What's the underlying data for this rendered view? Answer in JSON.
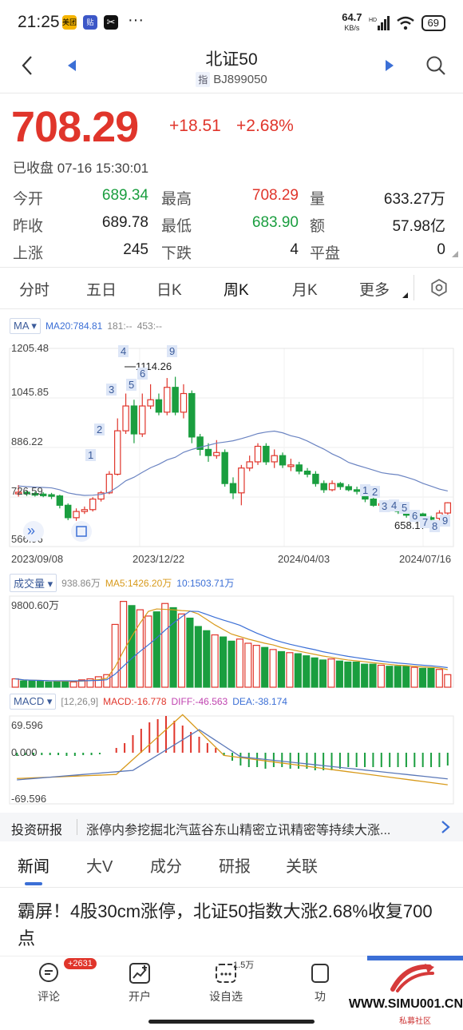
{
  "status_bar": {
    "time": "21:25",
    "app_badges": [
      "美团",
      "贴"
    ],
    "net_speed": "64.7",
    "net_unit": "KB/s",
    "battery": "69"
  },
  "header": {
    "title": "北证50",
    "index_tag": "指",
    "code": "BJ899050"
  },
  "quote": {
    "price": "708.29",
    "change": "+18.51",
    "change_pct": "+2.68%",
    "status": "已收盘 07-16 15:30:01",
    "rows": [
      [
        {
          "k": "今开",
          "v": "689.34",
          "c": "green"
        },
        {
          "k": "最高",
          "v": "708.29",
          "c": "red"
        },
        {
          "k": "量",
          "v": "633.27万",
          "c": ""
        }
      ],
      [
        {
          "k": "昨收",
          "v": "689.78",
          "c": ""
        },
        {
          "k": "最低",
          "v": "683.90",
          "c": "green"
        },
        {
          "k": "额",
          "v": "57.98亿",
          "c": ""
        }
      ],
      [
        {
          "k": "上涨",
          "v": "245",
          "c": ""
        },
        {
          "k": "下跌",
          "v": "4",
          "c": ""
        },
        {
          "k": "平盘",
          "v": "0",
          "c": ""
        }
      ]
    ]
  },
  "tabs": [
    "分时",
    "五日",
    "日K",
    "周K",
    "月K",
    "更多"
  ],
  "active_tab": "周K",
  "kline": {
    "ma_selector": "MA",
    "ma20": "MA20:784.81",
    "ma181": "181:--",
    "ma453": "453:--",
    "y_labels": [
      "1205.48",
      "1045.85",
      "886.22",
      "726.59",
      "566.96"
    ],
    "x_labels": [
      "2023/09/08",
      "2023/12/22",
      "2024/04/03",
      "2024/07/16"
    ],
    "high_annotation": "1114.26",
    "low_annotation": "658.17"
  },
  "volume": {
    "selector": "成交量",
    "value": "938.86万",
    "ma5": "MA5:1426.20万",
    "ma10": "10:1503.71万",
    "max_label": "9800.60万"
  },
  "macd": {
    "selector": "MACD",
    "params": "[12,26,9]",
    "macd": "MACD:-16.778",
    "diff": "DIFF:-46.563",
    "dea": "DEA:-38.174",
    "y_labels": [
      "69.596",
      "0.000",
      "-69.596"
    ]
  },
  "news_strip": {
    "label": "投资研报",
    "text": "涨停内参挖掘北汽蓝谷东山精密立讯精密等持续大涨..."
  },
  "news_tabs": [
    "新闻",
    "大V",
    "成分",
    "研报",
    "关联"
  ],
  "headline": "霸屏！4股30cm涨停，北证50指数大涨2.68%收复700点",
  "bottom_bar": [
    {
      "label": "评论",
      "badge": "+2631",
      "icon": "comment-icon"
    },
    {
      "label": "开户",
      "badge": "",
      "icon": "chart-plus-icon"
    },
    {
      "label": "设自选",
      "badge": "1.5万",
      "icon": "watchlist-icon"
    },
    {
      "label": "功",
      "badge": "",
      "icon": "more-icon"
    }
  ],
  "watermark": "WWW.SIMU001.CN",
  "watermark_sub": "私募社区",
  "colors": {
    "up": "#e0352b",
    "down": "#1a9e3f",
    "accent": "#3b6fd6"
  }
}
